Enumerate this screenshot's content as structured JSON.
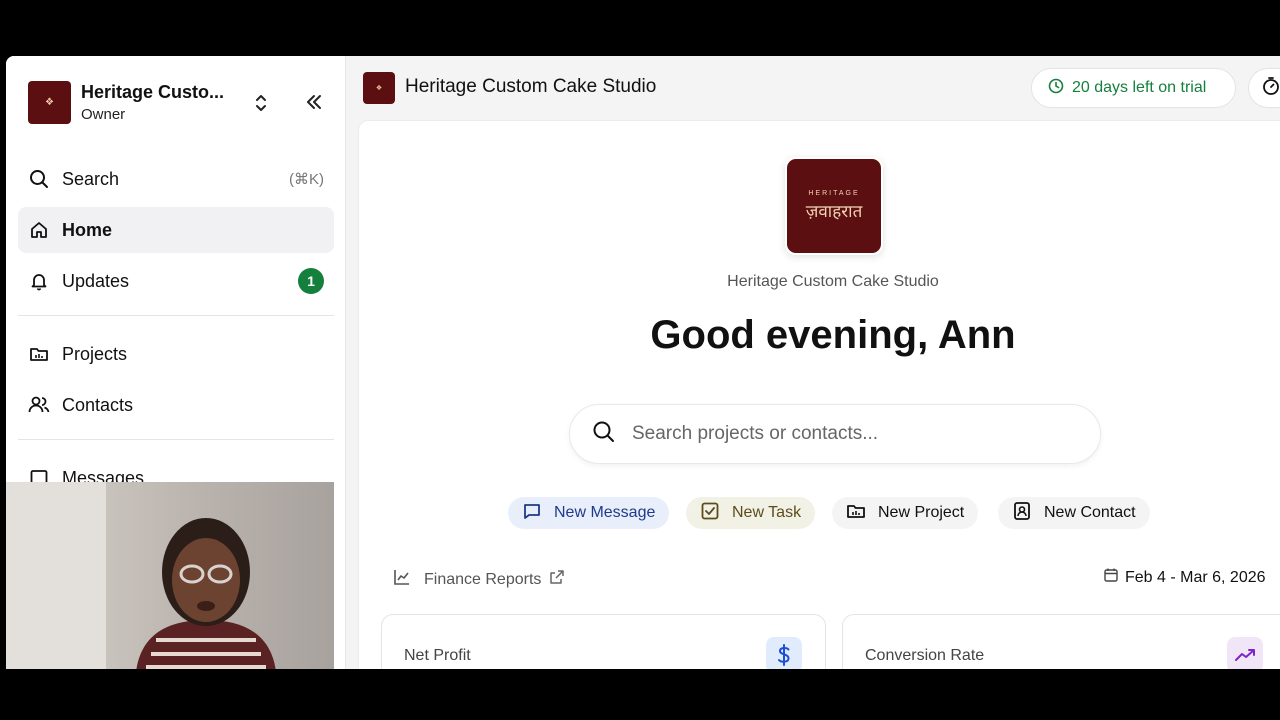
{
  "workspace": {
    "name": "Heritage Custo...",
    "role": "Owner"
  },
  "sidebar": {
    "items": [
      {
        "label": "Search",
        "shortcut": "(⌘K)",
        "icon": "search-icon"
      },
      {
        "label": "Home",
        "icon": "home-icon",
        "active": true
      },
      {
        "label": "Updates",
        "icon": "bell-icon",
        "badge": "1"
      },
      {
        "label": "Projects",
        "icon": "folder-icon"
      },
      {
        "label": "Contacts",
        "icon": "users-icon"
      },
      {
        "label": "Messages",
        "icon": "message-icon"
      }
    ]
  },
  "topbar": {
    "title": "Heritage Custom Cake Studio",
    "trial": "20 days left on trial"
  },
  "main": {
    "logo_small": "HERITAGE",
    "logo_big": "ज़वाहरात",
    "studio_name": "Heritage Custom Cake Studio",
    "greeting": "Good evening, Ann",
    "search_placeholder": "Search projects or contacts...",
    "quick_actions": [
      {
        "label": "New Message",
        "icon": "message-icon"
      },
      {
        "label": "New Task",
        "icon": "check-square-icon"
      },
      {
        "label": "New Project",
        "icon": "folder-icon"
      },
      {
        "label": "New Contact",
        "icon": "contact-card-icon"
      }
    ],
    "finance_label": "Finance Reports",
    "date_range": "Feb 4 - Mar 6, 2026",
    "cards": [
      {
        "title": "Net Profit",
        "icon": "dollar-icon"
      },
      {
        "title": "Conversion Rate",
        "icon": "trending-up-icon"
      }
    ]
  },
  "colors": {
    "brand_maroon": "#5c0f10",
    "trial_green": "#15803d",
    "badge_green": "#15803d"
  }
}
